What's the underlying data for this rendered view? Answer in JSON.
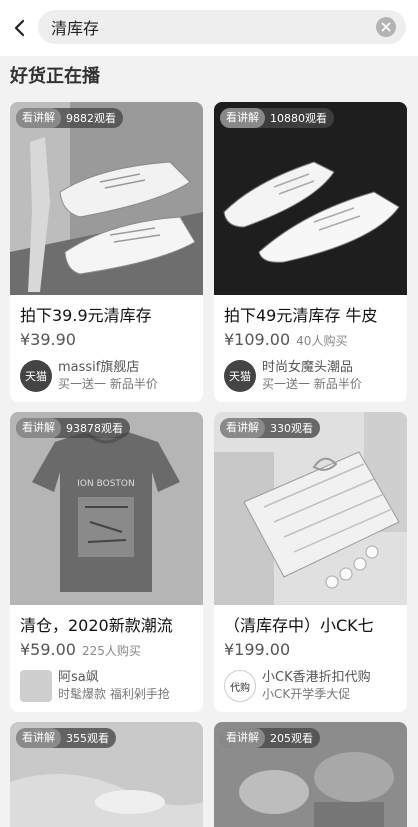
{
  "search": {
    "query": "清库存"
  },
  "section": {
    "title": "好货正在播"
  },
  "live_label": "看讲解",
  "products": [
    {
      "viewers": "9882观看",
      "title": "拍下39.9元清库存",
      "price": "¥39.90",
      "sold": "",
      "shop": {
        "logo": "天猫",
        "name": "massif旗舰店",
        "tags": "买一送一  新品半价"
      }
    },
    {
      "viewers": "10880观看",
      "title": "拍下49元清库存 牛皮",
      "price": "¥109.00",
      "sold": "40人购买",
      "shop": {
        "logo": "天猫",
        "name": "时尚女魔头潮品",
        "tags": "买一送一  新品半价"
      }
    },
    {
      "viewers": "93878观看",
      "title": "清仓，2020新款潮流",
      "price": "¥59.00",
      "sold": "225人购买",
      "shop": {
        "logo": "",
        "name": "阿sa飒",
        "tags": "时髦爆款  福利剁手抢"
      }
    },
    {
      "viewers": "330观看",
      "title": "（清库存中）小CK七",
      "price": "¥199.00",
      "sold": "",
      "shop": {
        "logo": "代购",
        "name": "小CK香港折扣代购",
        "tags": "小CK开学季大促"
      }
    },
    {
      "viewers": "355观看"
    },
    {
      "viewers": "205观看"
    }
  ],
  "shirt_print": "ION BOSTON"
}
